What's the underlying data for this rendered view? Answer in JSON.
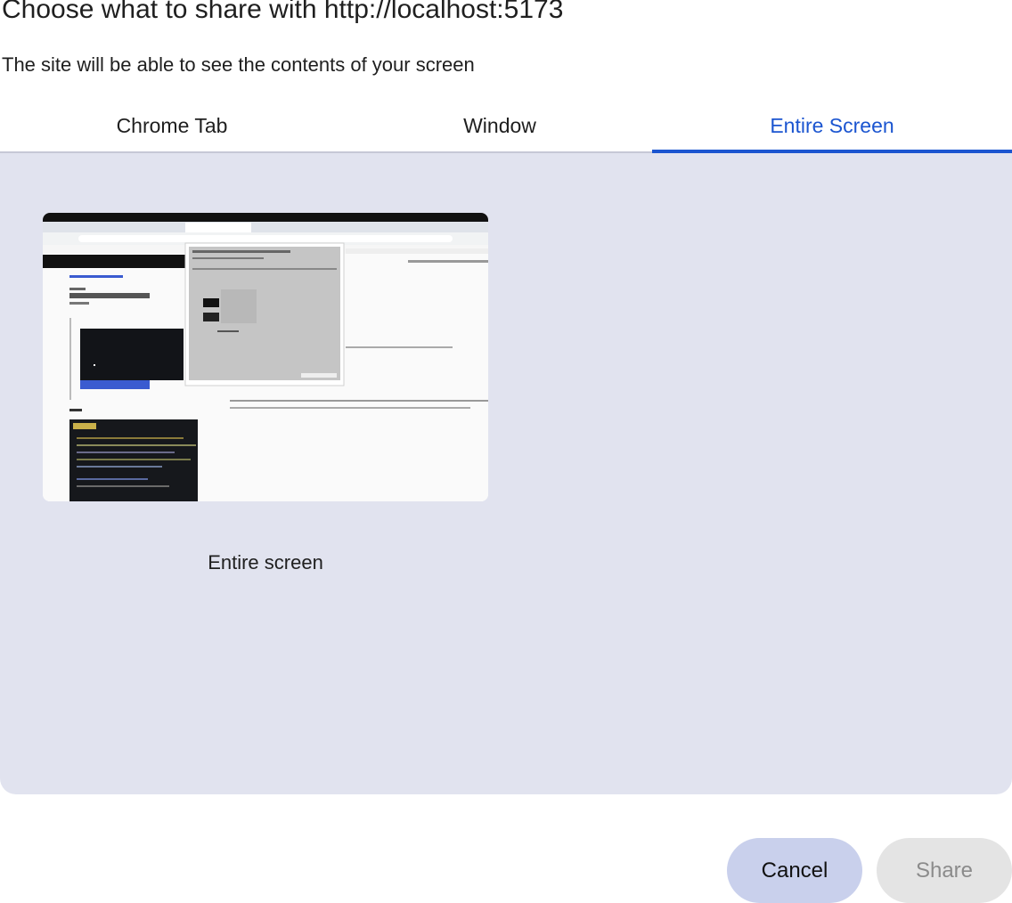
{
  "dialog": {
    "title": "Choose what to share with http://localhost:5173",
    "subtitle": "The site will be able to see the contents of your screen"
  },
  "tabs": [
    {
      "label": "Chrome Tab",
      "active": false
    },
    {
      "label": "Window",
      "active": false
    },
    {
      "label": "Entire Screen",
      "active": true
    }
  ],
  "sources": [
    {
      "label": "Entire screen",
      "kind": "screen-thumbnail"
    }
  ],
  "buttons": {
    "cancel": "Cancel",
    "share": "Share"
  },
  "colors": {
    "accent": "#1b55d0",
    "panel": "#e1e3ef",
    "cancel_bg": "#c9d0ec",
    "share_disabled_bg": "#e4e4e4"
  }
}
